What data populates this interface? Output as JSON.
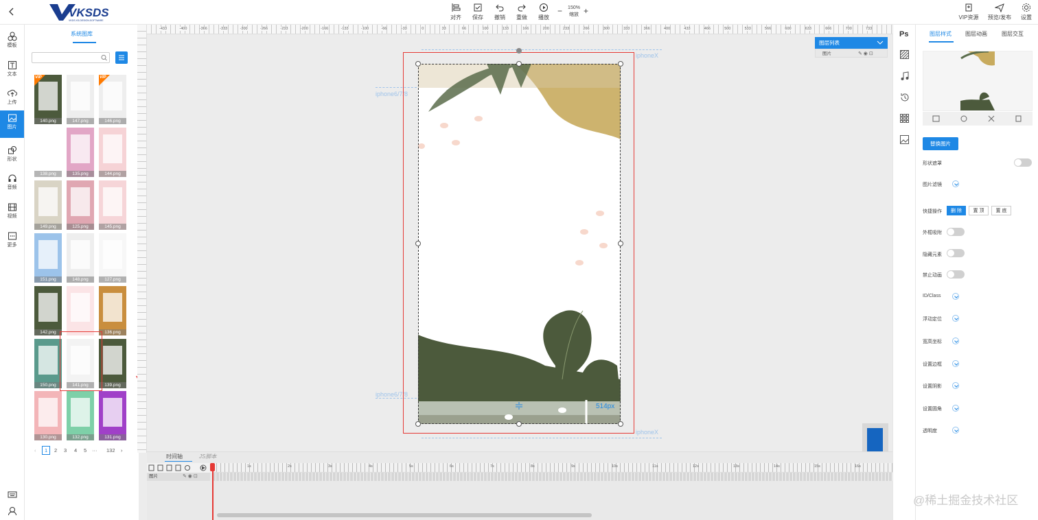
{
  "toolbar": {
    "align": "对齐",
    "save": "保存",
    "undo": "撤销",
    "redo": "重做",
    "play": "播放",
    "zoom_value": "150%",
    "zoom_label": "缩放",
    "zoom_minus": "−",
    "zoom_plus": "+",
    "vip": "VIP资源",
    "preview": "预览/发布",
    "settings": "设置"
  },
  "logo": {
    "text": "VKSDS",
    "sub": "VKDS.XS-DESIGN-SOFTWARE"
  },
  "leftnav": [
    "模板",
    "文本",
    "上传",
    "图片",
    "形状",
    "音频",
    "视频",
    "更多"
  ],
  "library": {
    "title": "系统图库",
    "search_placeholder": "",
    "thumbnails": [
      "140.png",
      "147.png",
      "146.png",
      "138.png",
      "135.png",
      "144.png",
      "149.png",
      "125.png",
      "145.png",
      "151.png",
      "148.png",
      "127.png",
      "142.png",
      "",
      "136.png",
      "150.png",
      "141.png",
      "139.png",
      "130.png",
      "132.png",
      "131.png"
    ],
    "vip_badge": "VIP",
    "pager": {
      "prev": "‹",
      "pages": [
        "1",
        "2",
        "3",
        "4",
        "5"
      ],
      "ellipsis": "···",
      "last": "132",
      "next": "›"
    }
  },
  "canvas": {
    "iphonex_label": "iphoneX",
    "iphone678_label": "iphone6/7/8",
    "height_label": "514px"
  },
  "layers": {
    "title": "图层列表",
    "row": "图片"
  },
  "timeline": {
    "tab_timeline": "时间轴",
    "tab_js": "JS脚本",
    "row_label": "图片",
    "seconds": [
      "1s",
      "2s",
      "3s",
      "4s",
      "5s",
      "6s",
      "7s",
      "8s",
      "9s",
      "10s",
      "11s",
      "12s",
      "13s",
      "14s",
      "15s",
      "16s"
    ]
  },
  "ruler": {
    "top": [
      "-433",
      "-400",
      "-366",
      "-333",
      "-300",
      "-266",
      "-233",
      "-200",
      "-166",
      "-133",
      "-100",
      "-66",
      "-33",
      "0",
      "33",
      "66",
      "100",
      "133",
      "166",
      "200",
      "233",
      "266",
      "300",
      "333",
      "366",
      "400",
      "433",
      "466",
      "500",
      "533",
      "566",
      "600",
      "633",
      "666",
      "700",
      "733"
    ]
  },
  "right_icons": {
    "ps": "Ps"
  },
  "props": {
    "tabs": [
      "图层样式",
      "图层动画",
      "图层交互"
    ],
    "replace": "替换图片",
    "shape_mask": "形状遮罩",
    "filter": "图片滤镜",
    "quick": "快捷操作",
    "quick_buttons": [
      "删 除",
      "置 顶",
      "置 底"
    ],
    "outer_snap": "外框吸附",
    "hide": "隐藏元素",
    "disable_anim": "禁止动画",
    "id_class": "ID/Class",
    "float": "浮动定位",
    "size_pos": "宽高坐标",
    "border": "设置边框",
    "shadow": "设置阴影",
    "radius": "设置圆角",
    "opacity": "透明度"
  },
  "watermark": "@稀土掘金技术社区",
  "colors": {
    "accent": "#1e88e5",
    "selection": "#e53935",
    "leaf_green": "#4a5a3a",
    "sand": "#c8ab5e"
  }
}
